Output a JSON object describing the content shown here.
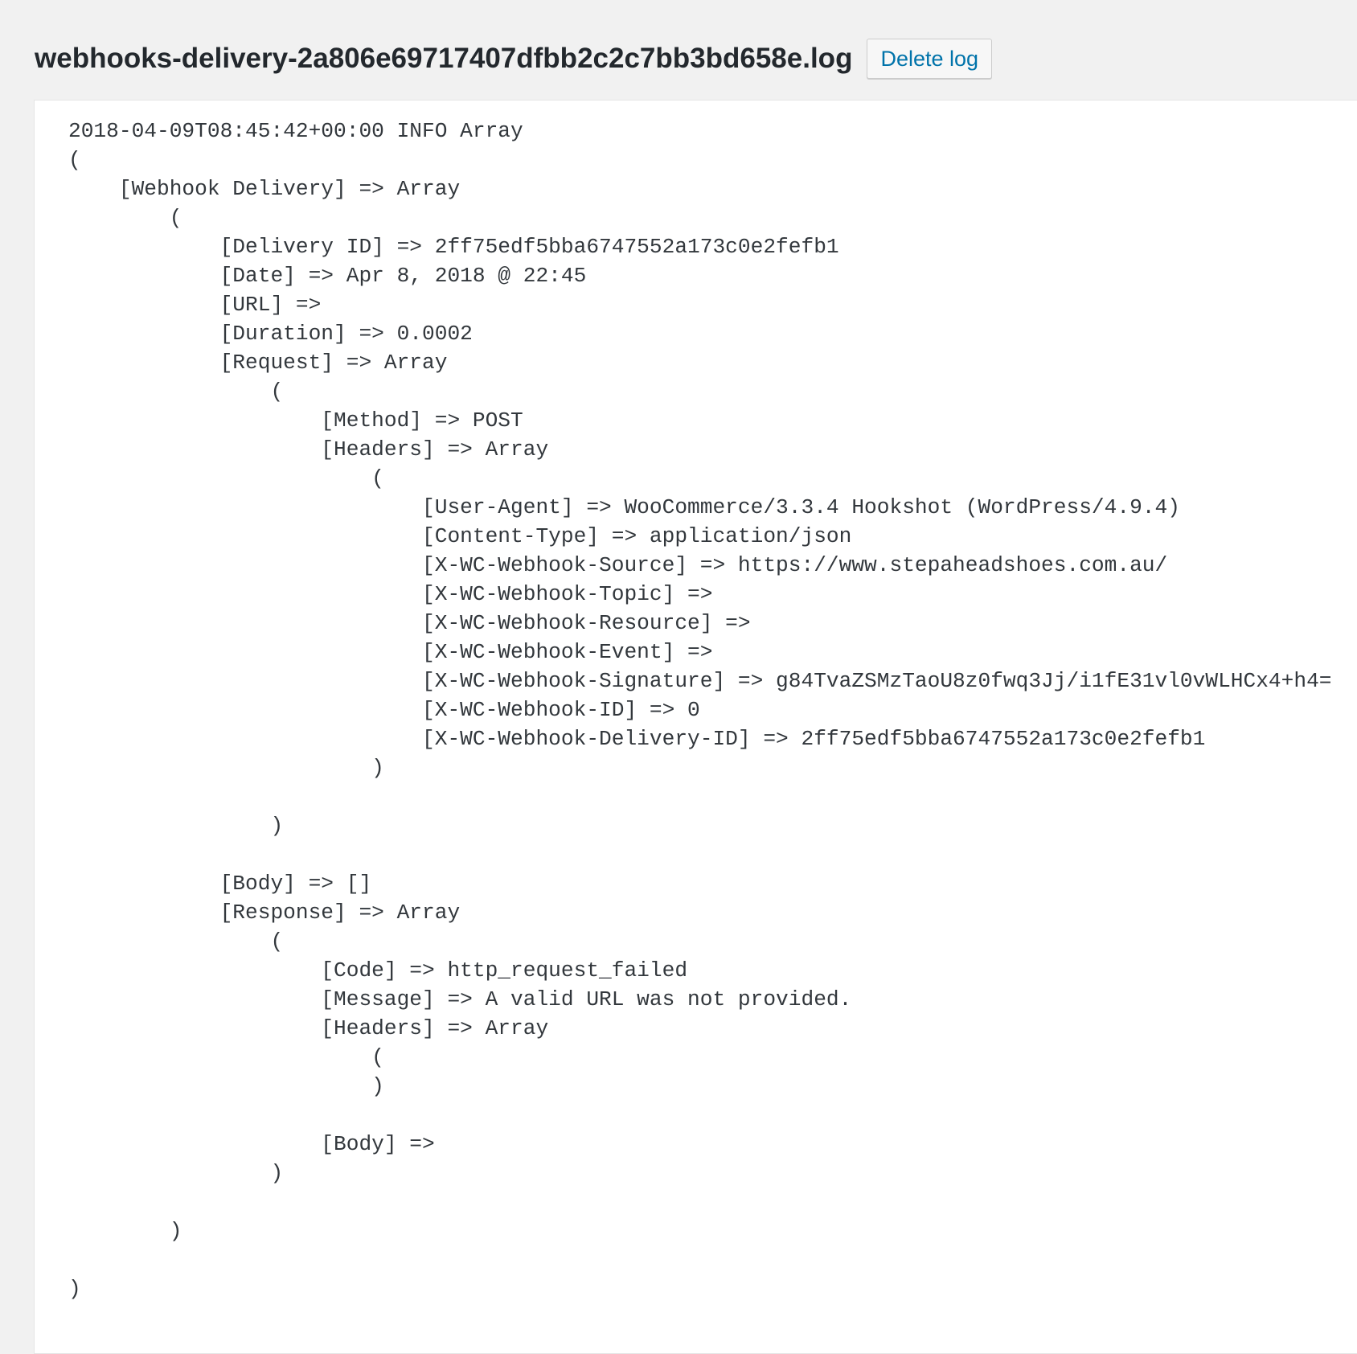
{
  "header": {
    "title": "webhooks-delivery-2a806e69717407dfbb2c2c7bb3bd658e.log",
    "delete_label": "Delete log"
  },
  "log": {
    "lines": [
      "2018-04-09T08:45:42+00:00 INFO Array",
      "(",
      "    [Webhook Delivery] => Array",
      "        (",
      "            [Delivery ID] => 2ff75edf5bba6747552a173c0e2fefb1",
      "            [Date] => Apr 8, 2018 @ 22:45",
      "            [URL] => ",
      "            [Duration] => 0.0002",
      "            [Request] => Array",
      "                (",
      "                    [Method] => POST",
      "                    [Headers] => Array",
      "                        (",
      "                            [User-Agent] => WooCommerce/3.3.4 Hookshot (WordPress/4.9.4)",
      "                            [Content-Type] => application/json",
      "                            [X-WC-Webhook-Source] => https://www.stepaheadshoes.com.au/",
      "                            [X-WC-Webhook-Topic] => ",
      "                            [X-WC-Webhook-Resource] => ",
      "                            [X-WC-Webhook-Event] => ",
      "                            [X-WC-Webhook-Signature] => g84TvaZSMzTaoU8z0fwq3Jj/i1fE31vl0vWLHCx4+h4=",
      "                            [X-WC-Webhook-ID] => 0",
      "                            [X-WC-Webhook-Delivery-ID] => 2ff75edf5bba6747552a173c0e2fefb1",
      "                        )",
      "",
      "                )",
      "",
      "            [Body] => []",
      "            [Response] => Array",
      "                (",
      "                    [Code] => http_request_failed",
      "                    [Message] => A valid URL was not provided.",
      "                    [Headers] => Array",
      "                        (",
      "                        )",
      "",
      "                    [Body] => ",
      "                )",
      "",
      "        )",
      "",
      ")"
    ]
  }
}
